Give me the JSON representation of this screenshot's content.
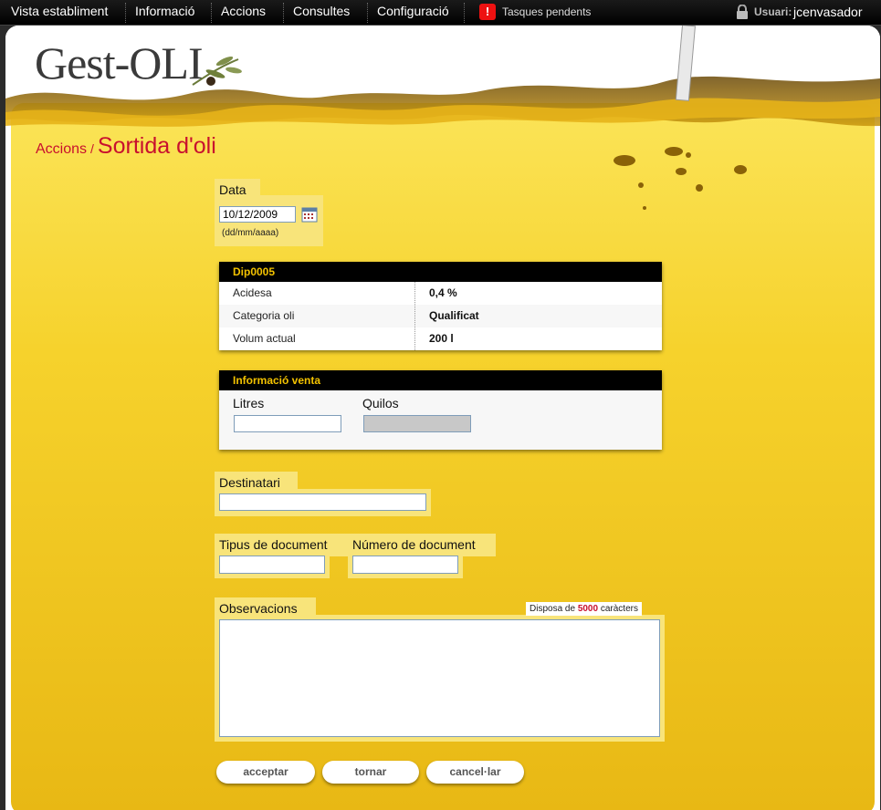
{
  "nav": {
    "items": [
      "Vista establiment",
      "Informació",
      "Accions",
      "Consultes",
      "Configuració"
    ],
    "tasks_label": "Tasques pendents",
    "user_label": "Usuari:",
    "user_name": "jcenvasador"
  },
  "logo": "Gest-OLI",
  "breadcrumb": {
    "parent": "Accions",
    "separator": "/",
    "title": "Sortida d'oli"
  },
  "date": {
    "label": "Data",
    "value": "10/12/2009",
    "hint": "(dd/mm/aaaa)"
  },
  "deposit": {
    "title": "Dip0005",
    "rows": [
      {
        "key": "Acidesa",
        "value": "0,4 %"
      },
      {
        "key": "Categoria oli",
        "value": "Qualificat"
      },
      {
        "key": "Volum actual",
        "value": "200 l"
      }
    ]
  },
  "sale": {
    "title": "Informació venta",
    "litres_label": "Litres",
    "quilos_label": "Quilos"
  },
  "recipient": {
    "label": "Destinatari"
  },
  "doc_type": {
    "label": "Tipus de document"
  },
  "doc_number": {
    "label": "Número de document"
  },
  "observations": {
    "label": "Observacions",
    "counter_prefix": "Disposa de",
    "counter_value": "5000",
    "counter_suffix": "caràcters"
  },
  "buttons": {
    "accept": "acceptar",
    "back": "tornar",
    "cancel": "cancel·lar"
  },
  "colors": {
    "accent": "#c8102e",
    "oil": "#f3c519",
    "header_text": "#f3c200"
  }
}
